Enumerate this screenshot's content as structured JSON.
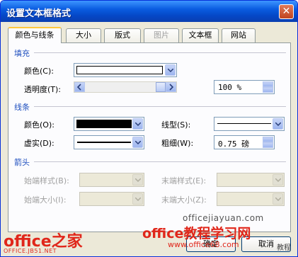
{
  "window": {
    "title": "设置文本框格式",
    "close_glyph": "✕"
  },
  "tabs": [
    {
      "label": "颜色与线条",
      "active": true
    },
    {
      "label": "大小"
    },
    {
      "label": "版式"
    },
    {
      "label": "图片",
      "disabled": true
    },
    {
      "label": "文本框"
    },
    {
      "label": "网站"
    }
  ],
  "fill": {
    "section_title": "填充",
    "color_label": "颜色(C):",
    "transparency_label": "透明度(T):",
    "transparency_value": "100 %",
    "transparency_level": 1.0,
    "fill_color": "#ffffff"
  },
  "line": {
    "section_title": "线条",
    "color_label": "颜色(O):",
    "line_color": "#000000",
    "dash_label": "虚实(D):",
    "style_label": "线型(S):",
    "weight_label": "粗细(W):",
    "weight_value": "0.75 磅"
  },
  "arrows": {
    "section_title": "箭头",
    "begin_style_label": "始端样式(B):",
    "begin_size_label": "始端大小(I):",
    "end_style_label": "末端样式(E):",
    "end_size_label": "末端大小(Z):"
  },
  "buttons": {
    "ok": "确定",
    "cancel": "取消"
  },
  "watermarks": {
    "site_a": "officejiayuan.com",
    "brand_a": "office之家",
    "brand_a_sub": "OFFICE.JB51.NET",
    "brand_b": "office教程学习网",
    "site_b": "www.office68.com",
    "tag": "教程"
  }
}
